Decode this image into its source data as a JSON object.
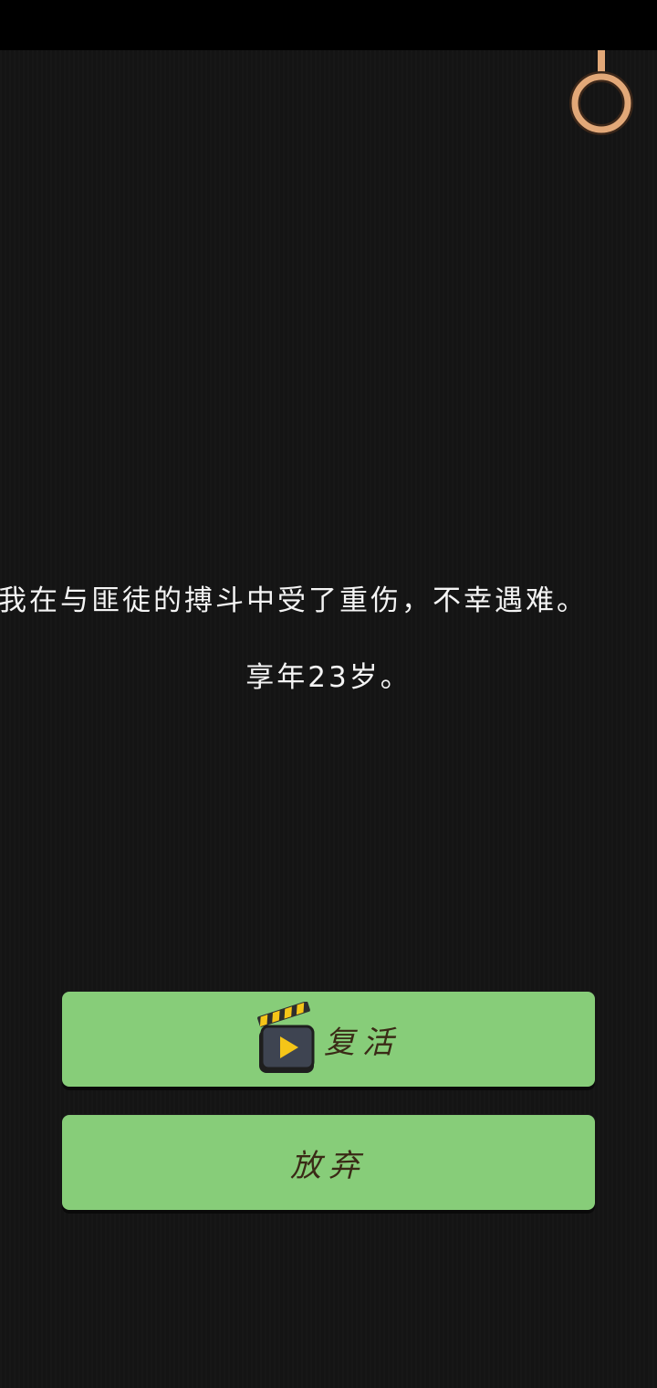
{
  "message": {
    "line1": "我在与匪徒的搏斗中受了重伤，不幸遇难。",
    "line2": "享年23岁。"
  },
  "buttons": {
    "revive_label": "复活",
    "revive_icon": "video-ad-icon",
    "giveup_label": "放弃"
  },
  "colors": {
    "background": "#141414",
    "button": "#87cd79",
    "button_text": "#3a2a16",
    "ring": "#e2a878"
  }
}
